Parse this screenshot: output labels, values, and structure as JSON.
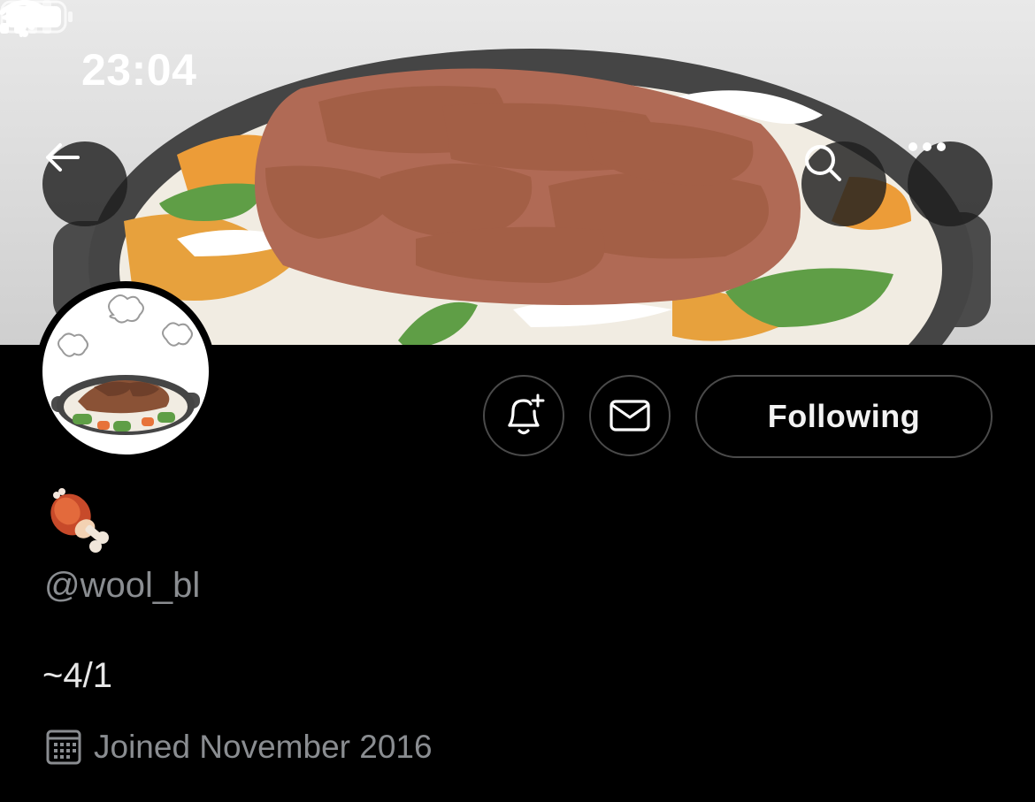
{
  "status_bar": {
    "time": "23:04",
    "icons": [
      "location-arrow-icon",
      "cellular-signal-icon",
      "wifi-icon",
      "battery-icon"
    ]
  },
  "header": {
    "buttons": [
      "back-arrow-icon",
      "search-icon",
      "more-dots-icon"
    ]
  },
  "profile": {
    "display_name_emoji": "meat-on-bone-emoji",
    "handle": "@wool_bl",
    "bio": "~4/1",
    "joined": "Joined November 2016"
  },
  "actions": {
    "following_label": "Following",
    "notify_icon": "bell-plus-icon",
    "dm_icon": "envelope-icon"
  },
  "colors": {
    "background": "#000000",
    "secondary_text": "#8a8d91",
    "button_border": "#4a4a4a"
  }
}
